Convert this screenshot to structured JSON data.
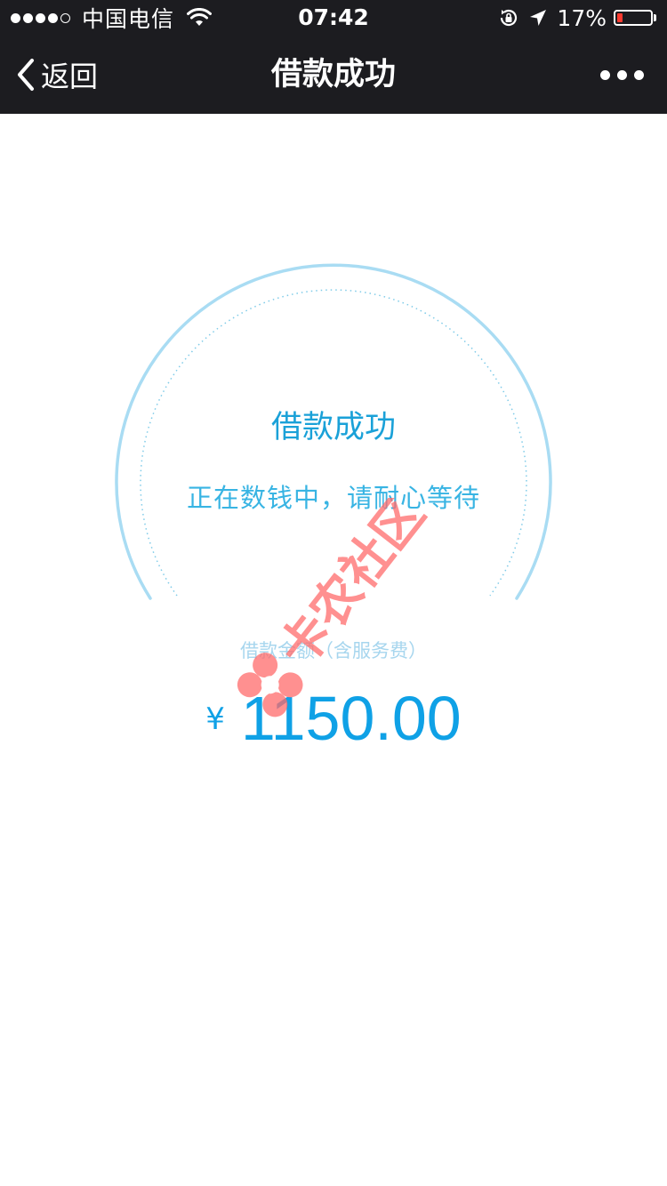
{
  "status_bar": {
    "carrier": "中国电信",
    "time": "07:42",
    "battery_percent": "17%",
    "battery_level": 0.17,
    "signal_bars_filled": 4,
    "signal_bars_total": 5,
    "icons": [
      "signal-dots",
      "wifi-icon",
      "rotation-lock-icon",
      "location-arrow-icon",
      "battery-icon"
    ]
  },
  "nav": {
    "back_label": "返回",
    "title": "借款成功",
    "back_icon": "chevron-left-icon",
    "more_icon": "more-dots-icon"
  },
  "result": {
    "title": "借款成功",
    "subtitle": "正在数钱中，请耐心等待"
  },
  "amount": {
    "label": "借款金额（含服务费）",
    "currency": "¥",
    "value": "1150.00"
  },
  "watermark": {
    "text": "卡农社区"
  },
  "colors": {
    "bar_bg": "#1c1c20",
    "accent": "#1aa1d8",
    "amount": "#0fa1e6",
    "arc": "#a9dcf3",
    "battery_low": "#ff3b30",
    "watermark": "#ff6b6b"
  }
}
